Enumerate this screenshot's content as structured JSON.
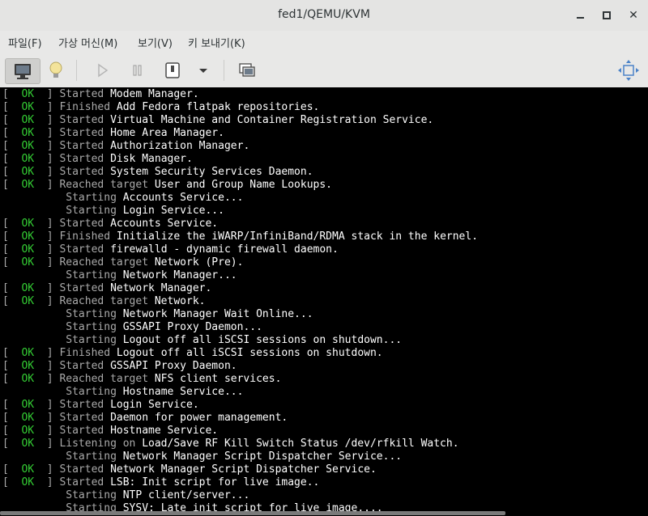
{
  "window": {
    "title": "fed1/QEMU/KVM"
  },
  "menu": [
    "파일(F)",
    "가상 머신(M)",
    "보기(V)",
    "키 보내기(K)"
  ],
  "console_lines": [
    {
      "status": "OK",
      "verb": "Started",
      "rest": "Modem Manager."
    },
    {
      "status": "OK",
      "verb": "Finished",
      "rest": "Add Fedora flatpak repositories."
    },
    {
      "status": "OK",
      "verb": "Started",
      "rest": "Virtual Machine and Container Registration Service."
    },
    {
      "status": "OK",
      "verb": "Started",
      "rest": "Home Area Manager."
    },
    {
      "status": "OK",
      "verb": "Started",
      "rest": "Authorization Manager."
    },
    {
      "status": "OK",
      "verb": "Started",
      "rest": "Disk Manager."
    },
    {
      "status": "OK",
      "verb": "Started",
      "rest": "System Security Services Daemon."
    },
    {
      "status": "OK",
      "verb": "Reached target",
      "rest": "User and Group Name Lookups."
    },
    {
      "status": "",
      "verb": "Starting",
      "rest": "Accounts Service..."
    },
    {
      "status": "",
      "verb": "Starting",
      "rest": "Login Service..."
    },
    {
      "status": "OK",
      "verb": "Started",
      "rest": "Accounts Service."
    },
    {
      "status": "OK",
      "verb": "Finished",
      "rest": "Initialize the iWARP/InfiniBand/RDMA stack in the kernel."
    },
    {
      "status": "OK",
      "verb": "Started",
      "rest": "firewalld - dynamic firewall daemon."
    },
    {
      "status": "OK",
      "verb": "Reached target",
      "rest": "Network (Pre)."
    },
    {
      "status": "",
      "verb": "Starting",
      "rest": "Network Manager..."
    },
    {
      "status": "OK",
      "verb": "Started",
      "rest": "Network Manager."
    },
    {
      "status": "OK",
      "verb": "Reached target",
      "rest": "Network."
    },
    {
      "status": "",
      "verb": "Starting",
      "rest": "Network Manager Wait Online..."
    },
    {
      "status": "",
      "verb": "Starting",
      "rest": "GSSAPI Proxy Daemon..."
    },
    {
      "status": "",
      "verb": "Starting",
      "rest": "Logout off all iSCSI sessions on shutdown..."
    },
    {
      "status": "OK",
      "verb": "Finished",
      "rest": "Logout off all iSCSI sessions on shutdown."
    },
    {
      "status": "OK",
      "verb": "Started",
      "rest": "GSSAPI Proxy Daemon."
    },
    {
      "status": "OK",
      "verb": "Reached target",
      "rest": "NFS client services."
    },
    {
      "status": "",
      "verb": "Starting",
      "rest": "Hostname Service..."
    },
    {
      "status": "OK",
      "verb": "Started",
      "rest": "Login Service."
    },
    {
      "status": "OK",
      "verb": "Started",
      "rest": "Daemon for power management."
    },
    {
      "status": "OK",
      "verb": "Started",
      "rest": "Hostname Service."
    },
    {
      "status": "OK",
      "verb": "Listening on",
      "rest": "Load/Save RF Kill Switch Status /dev/rfkill Watch."
    },
    {
      "status": "",
      "verb": "Starting",
      "rest": "Network Manager Script Dispatcher Service..."
    },
    {
      "status": "OK",
      "verb": "Started",
      "rest": "Network Manager Script Dispatcher Service."
    },
    {
      "status": "OK",
      "verb": "Started",
      "rest": "LSB: Init script for live image.."
    },
    {
      "status": "",
      "verb": "Starting",
      "rest": "NTP client/server..."
    },
    {
      "status": "",
      "verb": "Starting",
      "rest": "SYSV: Late init script for live image...."
    }
  ],
  "colors": {
    "ok": "#33cc33",
    "console_bg": "#000000",
    "console_fg": "#aaaaaa",
    "highlight": "#ffffff"
  }
}
